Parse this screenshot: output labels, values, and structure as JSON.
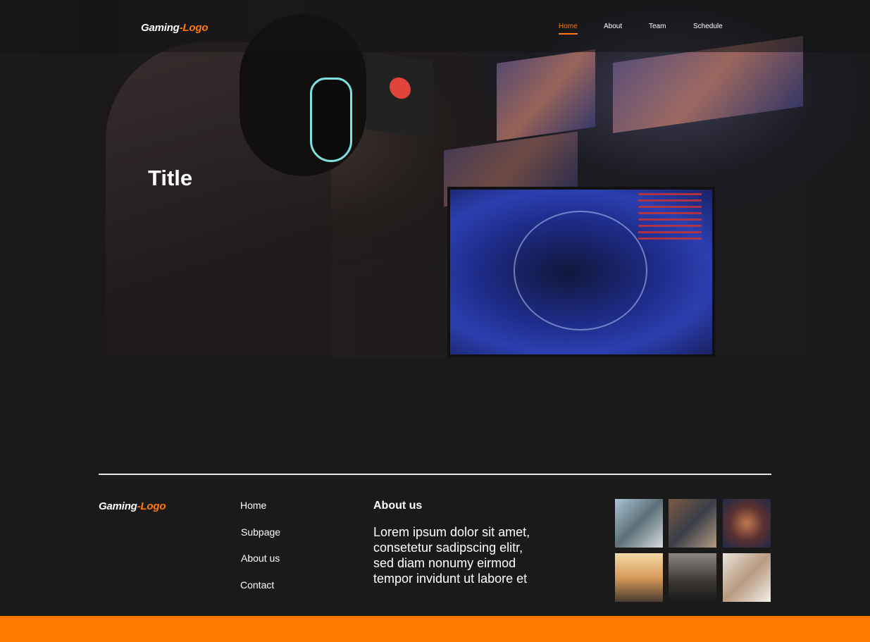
{
  "header": {
    "logo_part1": "Gaming",
    "logo_part2": "-Logo",
    "nav": [
      {
        "label": "Home",
        "active": true
      },
      {
        "label": "About"
      },
      {
        "label": "Team"
      },
      {
        "label": "Schedule"
      }
    ]
  },
  "hero": {
    "title": "Title"
  },
  "footer": {
    "logo_part1": "Gaming",
    "logo_part2": "-Logo",
    "links": [
      "Home",
      "Subpage",
      "About us",
      "Contact"
    ],
    "about_heading": "About us",
    "about_text": "Lorem ipsum dolor sit amet, consetetur sadipscing elitr, sed diam nonumy eirmod tempor invidunt ut labore et"
  },
  "colors": {
    "accent": "#ff7800",
    "background": "#1a1a1a"
  }
}
